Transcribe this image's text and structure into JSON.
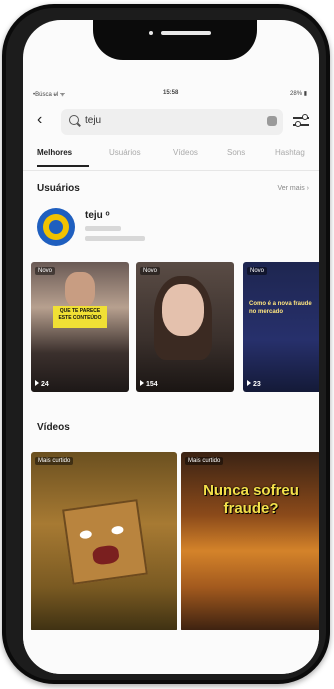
{
  "status_bar": {
    "carrier": "•Búsca ᵾl ᯤ",
    "time": "15:58",
    "battery": "28% ▮"
  },
  "search": {
    "query": "teju",
    "back_glyph": "‹"
  },
  "tabs": [
    {
      "label": "Melhores"
    },
    {
      "label": "Usuários"
    },
    {
      "label": "Vídeos"
    },
    {
      "label": "Sons"
    },
    {
      "label": "Hashtag"
    }
  ],
  "users_section": {
    "title": "Usuários",
    "see_more": "Ver mais ›",
    "user": {
      "name": "teju ᵒ"
    },
    "thumbs": [
      {
        "badge": "Novo",
        "views": "24",
        "label": "QUE TE PARECE ESTE CONTEÚDO"
      },
      {
        "badge": "Novo",
        "views": "154",
        "label": ""
      },
      {
        "badge": "Novo",
        "views": "23",
        "label": "Como é a nova fraude no mercado"
      }
    ]
  },
  "videos_section": {
    "title": "Vídeos",
    "videos": [
      {
        "badge": "Mais curtido",
        "title": ""
      },
      {
        "badge": "Mais curtido",
        "title": "Nunca sofreu fraude?"
      }
    ]
  }
}
